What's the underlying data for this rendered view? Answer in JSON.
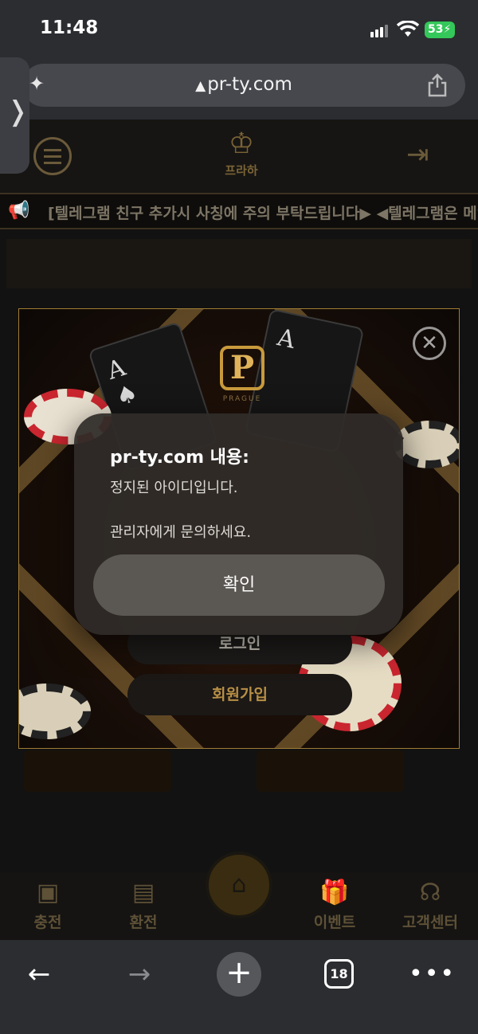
{
  "status_bar": {
    "time": "11:48",
    "battery": "53"
  },
  "browser": {
    "url": "pr-ty.com",
    "tab_count": "18"
  },
  "site": {
    "logo_text": "프라하",
    "marquee": "[텔레그램 친구 추가시 사칭에 주의 부탁드립니다▶ ◀텔레그램은 메인",
    "promo": {
      "emblem_letter": "P",
      "emblem_sub": "PRAGUE",
      "login_label": "로그인",
      "signup_label": "회원가입"
    },
    "bottom_nav": [
      {
        "label": "충전",
        "icon": "deposit-icon"
      },
      {
        "label": "환전",
        "icon": "withdraw-icon"
      },
      {
        "label": "",
        "icon": "home-icon"
      },
      {
        "label": "이벤트",
        "icon": "gift-icon"
      },
      {
        "label": "고객센터",
        "icon": "headset-icon"
      }
    ]
  },
  "alert": {
    "title": "pr-ty.com 내용:",
    "line1": "정지된 아이디입니다.",
    "line2": "관리자에게 문의하세요.",
    "ok_label": "확인"
  }
}
